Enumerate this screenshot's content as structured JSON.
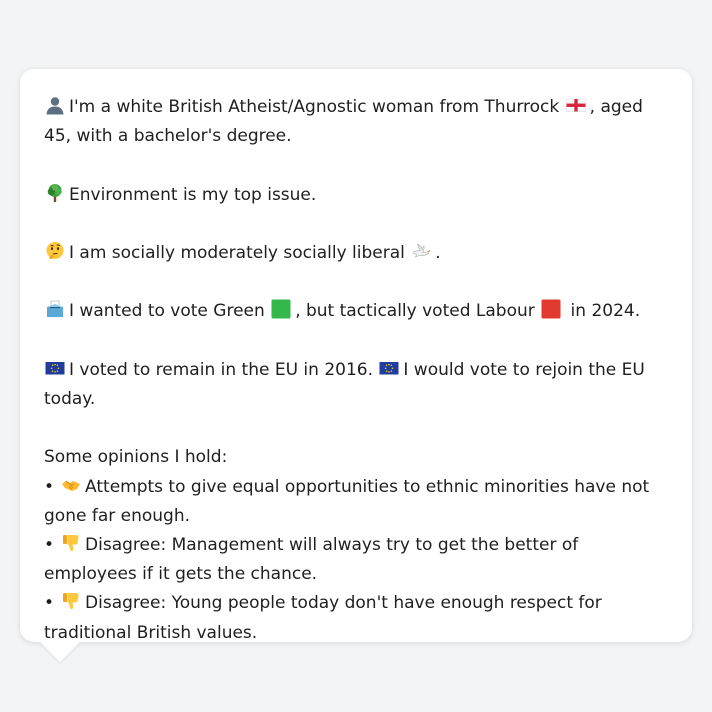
{
  "profile": {
    "intro_text": "I'm a white British Atheist/Agnostic woman from Thurrock ",
    "intro_age": ", aged 45, with a bachelor's degree.",
    "issue_text": "Environment is my top issue.",
    "social_text": "I am socially moderately socially liberal ",
    "social_end": ".",
    "vote_a": "I wanted to vote Green ",
    "vote_b": ", but tactically voted Labour ",
    "vote_c": " in 2024.",
    "eu_a": "I voted to remain in the EU in 2016. ",
    "eu_b": "I would vote to rejoin the EU today.",
    "opinions_heading": "Some opinions I hold:",
    "bullet_char": "•",
    "opinions": [
      {
        "text": "Attempts to give equal opportunities to ethnic minorities have not gone far enough."
      },
      {
        "text": "Disagree: Management will always try to get the better of employees if it gets the chance."
      },
      {
        "text": "Disagree: Young people today don't have enough respect for traditional British values."
      }
    ]
  },
  "icons": {
    "person": "person-silhouette-icon",
    "england_flag": "england-flag-icon",
    "tree": "deciduous-tree-icon",
    "thinking": "thinking-face-icon",
    "dove": "dove-icon",
    "ballot": "ballot-box-icon",
    "green_square": "green-square-icon",
    "red_square": "red-square-icon",
    "eu_flag": "eu-flag-icon",
    "handshake": "handshake-icon",
    "thumbs_down": "thumbs-down-icon"
  },
  "colors": {
    "background": "#f3f4f6",
    "bubble": "#ffffff",
    "text": "#1f1f1f",
    "green": "#35b84b",
    "red": "#e23a2e",
    "eu_blue": "#1f3c9e"
  }
}
